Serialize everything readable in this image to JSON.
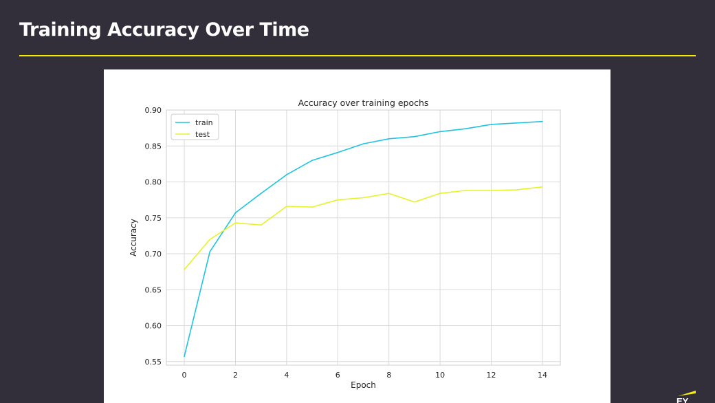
{
  "slide": {
    "title": "Training Accuracy Over Time",
    "accent_color": "#f5ec0a",
    "background_color": "#322f3b"
  },
  "logo": {
    "text": "EY",
    "icon": "ey-logo-icon"
  },
  "chart_data": {
    "type": "line",
    "title": "Accuracy over training epochs",
    "xlabel": "Epoch",
    "ylabel": "Accuracy",
    "xlim": [
      -0.7,
      14.7
    ],
    "ylim": [
      0.545,
      0.9
    ],
    "xticks": [
      0,
      2,
      4,
      6,
      8,
      10,
      12,
      14
    ],
    "xtick_labels": [
      "0",
      "2",
      "4",
      "6",
      "8",
      "10",
      "12",
      "14"
    ],
    "yticks": [
      0.55,
      0.6,
      0.65,
      0.7,
      0.75,
      0.8,
      0.85,
      0.9
    ],
    "ytick_labels": [
      "0.55",
      "0.60",
      "0.65",
      "0.70",
      "0.75",
      "0.80",
      "0.85",
      "0.90"
    ],
    "grid": true,
    "legend_position": "top-left",
    "x": [
      0,
      1,
      2,
      3,
      4,
      5,
      6,
      7,
      8,
      9,
      10,
      11,
      12,
      13,
      14
    ],
    "series": [
      {
        "name": "train",
        "color": "#1fc3df",
        "values": [
          0.557,
          0.703,
          0.757,
          0.784,
          0.81,
          0.83,
          0.841,
          0.853,
          0.86,
          0.863,
          0.87,
          0.874,
          0.88,
          0.882,
          0.884
        ]
      },
      {
        "name": "test",
        "color": "#e6f229",
        "values": [
          0.678,
          0.72,
          0.743,
          0.74,
          0.766,
          0.765,
          0.775,
          0.778,
          0.784,
          0.772,
          0.784,
          0.788,
          0.788,
          0.789,
          0.793
        ]
      }
    ]
  }
}
